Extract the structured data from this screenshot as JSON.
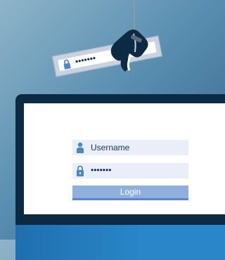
{
  "login": {
    "username_placeholder": "Username",
    "password_value": "•••••••",
    "button_label": "Login"
  },
  "stolen_card": {
    "password_value": "•••••••"
  },
  "colors": {
    "background_from": "#8fb4c9",
    "background_to": "#2f5f86",
    "monitor": "#0d2a45",
    "field_bg": "#e9eef9",
    "button_bg": "#8fb0de",
    "accent": "#1f6fae"
  },
  "icons": [
    "user-icon",
    "lock-icon",
    "fishing-hook-icon",
    "thief-hand-icon"
  ]
}
